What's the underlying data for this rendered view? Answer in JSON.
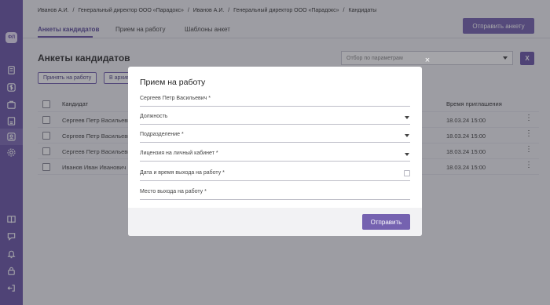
{
  "breadcrumb": [
    "Иванов А.И.",
    "/",
    "Генеральный директор ООО «Парадокс»",
    "/",
    "Иванов А.И.",
    "/",
    "Генеральный директор ООО «Парадокс»",
    "/",
    "Кандидаты"
  ],
  "tabs": [
    "Анкеты кандидатов",
    "Прием на работу",
    "Шаблоны анкет"
  ],
  "header": {
    "send_button": "Отправить анкету"
  },
  "sidebar": {
    "logo_text": "ФЛ",
    "icons": [
      "document-icon",
      "dollar-icon",
      "briefcase-icon",
      "id-card-icon",
      "users-icon",
      "settings-icon",
      "book-icon",
      "chat-icon",
      "bell-icon",
      "lock-icon",
      "logout-icon"
    ]
  },
  "page": {
    "title": "Анкеты кандидатов",
    "filter_placeholder": "Отбор по параметрам",
    "excel_label": "X",
    "actions": [
      "Принять на работу",
      "В архив"
    ],
    "columns": [
      "Кандидат",
      "Время приглашения"
    ],
    "rows": [
      {
        "name": "Сергеев Петр Васильевич",
        "time": "18.03.24 15:00"
      },
      {
        "name": "Сергеев Петр Васильевич",
        "time": "18.03.24 15:00"
      },
      {
        "name": "Сергеев Петр Васильевич",
        "time": "18.03.24 15:00"
      },
      {
        "name": "Иванов Иван Иванович",
        "time": "18.03.24 15:00"
      }
    ]
  },
  "modal": {
    "close_symbol": "×",
    "title": "Прием на работу",
    "fields": [
      {
        "label": "Сергеев Петр Васильевич",
        "required": "*"
      },
      {
        "label": "Должность",
        "required": ""
      },
      {
        "label": "Подразделение",
        "required": "*"
      },
      {
        "label": "Лицензия на личный кабинет",
        "required": "*"
      },
      {
        "label": "Дата и время выхода на работу",
        "required": "*"
      },
      {
        "label": "Место выхода на работу",
        "required": "*"
      }
    ],
    "submit": "Отправить"
  },
  "colors": {
    "accent": "#7562b0",
    "sidebar": "#6b56a8"
  }
}
